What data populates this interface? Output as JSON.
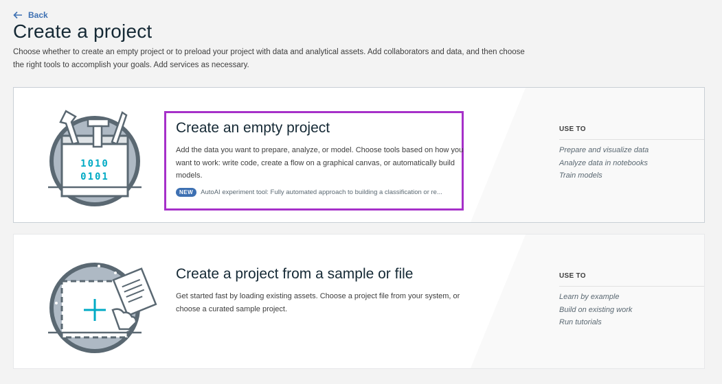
{
  "nav": {
    "back_label": "Back"
  },
  "page": {
    "title": "Create a project",
    "description": "Choose whether to create an empty project or to preload your project with data and analytical assets. Add collaborators and data, and then choose the right tools to accomplish your goals. Add services as necessary."
  },
  "cards": [
    {
      "title": "Create an empty project",
      "description": "Add the data you want to prepare, analyze, or model. Choose tools based on how you want to work: write code, create a flow on a graphical canvas, or automatically build models.",
      "badge": "NEW",
      "badge_text": "AutoAI experiment tool: Fully automated approach to building a classification or re...",
      "illustration_text": [
        "1010",
        "0101"
      ],
      "use_to_heading": "USE TO",
      "use_to": [
        "Prepare and visualize data",
        "Analyze data in notebooks",
        "Train models"
      ]
    },
    {
      "title": "Create a project from a sample or file",
      "description": "Get started fast by loading existing assets. Choose a project file from your system, or choose a curated sample project.",
      "use_to_heading": "USE TO",
      "use_to": [
        "Learn by example",
        "Build on existing work",
        "Run tutorials"
      ]
    }
  ],
  "colors": {
    "accent": "#3d70b2",
    "highlight": "#a630c9",
    "teal": "#00aac4"
  }
}
